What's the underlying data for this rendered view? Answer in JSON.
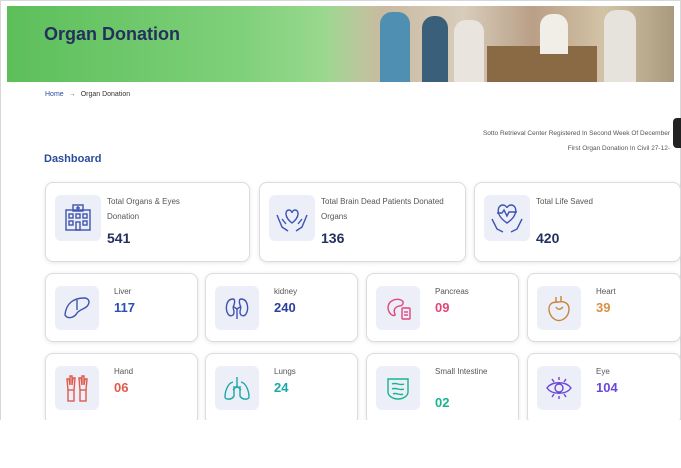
{
  "header": {
    "title": "Organ Donation"
  },
  "breadcrumb": {
    "home": "Home",
    "separator": "→",
    "current": "Organ Donation"
  },
  "notices": {
    "line1": "Sotto Retrieval Center Registered In Second Week Of December",
    "line2": "First Organ Donation In Civil 27-12-"
  },
  "dashboard": {
    "title": "Dashboard",
    "summary": [
      {
        "label": "Total Organs & Eyes Donation",
        "value": "541",
        "icon": "hospital-icon"
      },
      {
        "label": "Total Brain Dead Patients Donated Organs",
        "value": "136",
        "icon": "hands-heart-icon"
      },
      {
        "label": "Total Life Saved",
        "value": "420",
        "icon": "heart-pulse-hands-icon"
      }
    ],
    "organs": [
      {
        "label": "Liver",
        "value": "117",
        "color": "#2b4fb5",
        "icon": "liver-icon"
      },
      {
        "label": "kidney",
        "value": "240",
        "color": "#2b3f9e",
        "icon": "kidney-icon"
      },
      {
        "label": "Pancreas",
        "value": "09",
        "color": "#e0457d",
        "icon": "pancreas-icon"
      },
      {
        "label": "Heart",
        "value": "39",
        "color": "#d89142",
        "icon": "heart-organ-icon"
      },
      {
        "label": "Hand",
        "value": "06",
        "color": "#e05a4b",
        "icon": "hand-icon"
      },
      {
        "label": "Lungs",
        "value": "24",
        "color": "#1aa8a8",
        "icon": "lungs-icon"
      },
      {
        "label": "Small Intestine",
        "value": "02",
        "color": "#19b38f",
        "icon": "intestine-icon"
      },
      {
        "label": "Eye",
        "value": "104",
        "color": "#6b46d8",
        "icon": "eye-icon"
      }
    ]
  }
}
